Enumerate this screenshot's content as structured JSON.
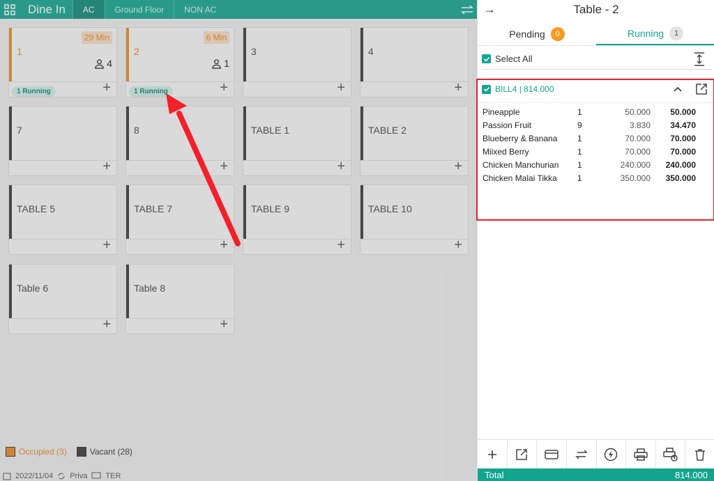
{
  "left": {
    "title": "Dine In",
    "tabs": [
      "AC",
      "Ground Floor",
      "NON AC"
    ],
    "icons": {
      "grid": "grid-icon",
      "right": "swap-icon"
    },
    "tables": [
      {
        "name": "1",
        "occupied": true,
        "time": "29 Min",
        "guests": "4",
        "running": "1 Running"
      },
      {
        "name": "2",
        "occupied": true,
        "time": "6 Min",
        "guests": "1",
        "running": "1 Running"
      },
      {
        "name": "3"
      },
      {
        "name": "4"
      },
      {
        "name": "7"
      },
      {
        "name": "8"
      },
      {
        "name": "TABLE 1"
      },
      {
        "name": "TABLE 2"
      },
      {
        "name": "TABLE 5"
      },
      {
        "name": "TABLE 7"
      },
      {
        "name": "TABLE 9"
      },
      {
        "name": "TABLE 10"
      },
      {
        "name": "Table 6"
      },
      {
        "name": "Table 8"
      }
    ],
    "legend": {
      "occupied": "Occupied (3)",
      "vacant": "Vacant (28)"
    },
    "footer": {
      "date": "2022/11/04",
      "mode": "Priva",
      "other": "TER"
    }
  },
  "right": {
    "title": "Table - 2",
    "tabs": [
      {
        "label": "Pending",
        "count": "0"
      },
      {
        "label": "Running",
        "count": "1"
      }
    ],
    "select_all": "Select All",
    "bill": {
      "title": "BILL4 | 814.000",
      "items": [
        {
          "name": "Pineapple",
          "qty": "1",
          "rate": "50.000",
          "amount": "50.000"
        },
        {
          "name": "Passion Fruit",
          "qty": "9",
          "rate": "3.830",
          "amount": "34.470"
        },
        {
          "name": "Blueberry & Banana",
          "qty": "1",
          "rate": "70.000",
          "amount": "70.000"
        },
        {
          "name": "Miixed Berry",
          "qty": "1",
          "rate": "70.000",
          "amount": "70.000"
        },
        {
          "name": "Chicken Manchurian",
          "qty": "1",
          "rate": "240.000",
          "amount": "240.000"
        },
        {
          "name": "Chicken Malai Tikka",
          "qty": "1",
          "rate": "350.000",
          "amount": "350.000"
        }
      ]
    },
    "actions": [
      "plus-icon",
      "open-external-icon",
      "card-icon",
      "transfer-icon",
      "lightning-icon",
      "printer-icon",
      "print-settings-icon",
      "trash-icon"
    ],
    "total": {
      "label": "Total",
      "value": "814.000"
    }
  },
  "colors": {
    "accent": "#14a58f",
    "occupied": "#e88a26",
    "vacant": "#3a3a3a",
    "highlight": "#e8212a",
    "pending_badge": "#f39c1f"
  }
}
